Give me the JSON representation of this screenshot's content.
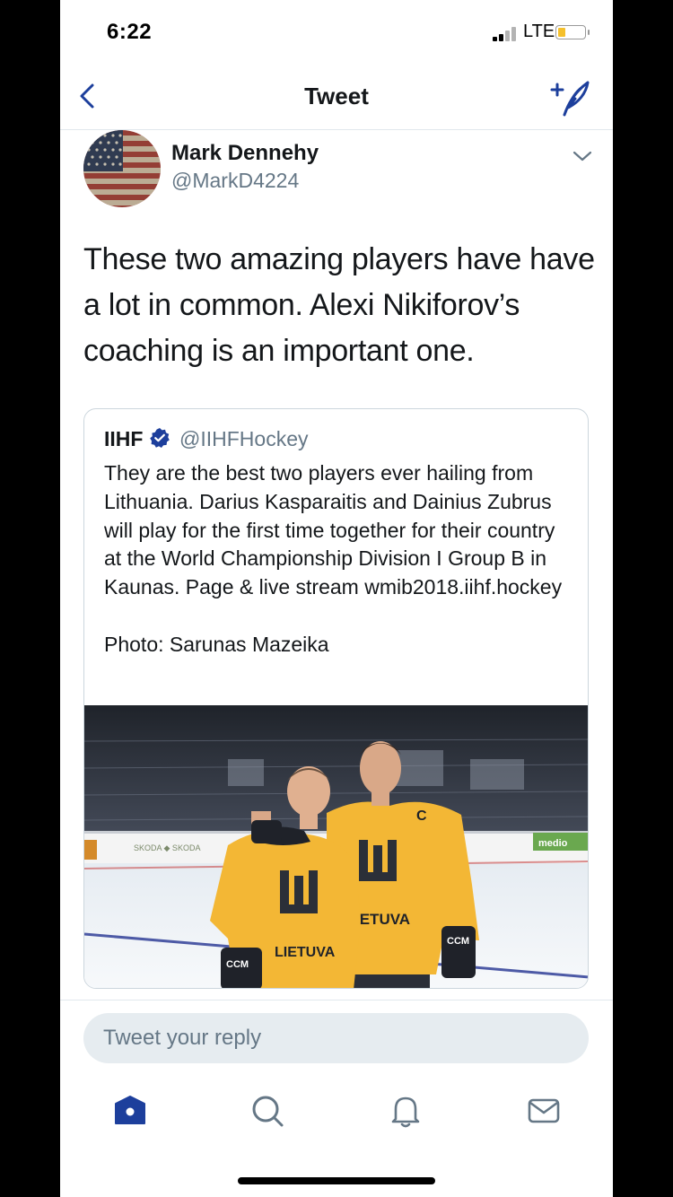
{
  "status_bar": {
    "time": "6:22",
    "carrier": "LTE",
    "battery_color": "#f5c02c"
  },
  "nav": {
    "title": "Tweet",
    "back_icon": "chevron-left-icon",
    "compose_icon": "compose-tweet-icon"
  },
  "tweet": {
    "author_name": "Mark Dennehy",
    "author_handle": "@MarkD4224",
    "text": "These two amazing players have have a lot in common.  Alexi Nikiforov’s coaching is an important one."
  },
  "quote": {
    "name": "IIHF",
    "handle": "@IIHFHockey",
    "verified_icon": "verified-badge-icon",
    "text": "They are the best two players ever hailing from Lithuania. Darius Kasparaitis and Dainius Zubrus will play for the first time together for their country at the World Championship Division I Group B in Kaunas. Page & live stream wmib2018.iihf.hockey\n\nPhoto: Sarunas Mazeika",
    "photo": {
      "jersey_text": "LIETUVA",
      "captain_mark": "C",
      "glove_left": "CCM",
      "glove_right": "CCM",
      "board_ads": "SKODA SKODA",
      "board_ad_right": "medio"
    }
  },
  "reply": {
    "placeholder": "Tweet your reply"
  },
  "tabs": [
    {
      "name": "home",
      "icon": "home-icon",
      "active": true
    },
    {
      "name": "search",
      "icon": "search-icon",
      "active": false
    },
    {
      "name": "notifications",
      "icon": "bell-icon",
      "active": false
    },
    {
      "name": "messages",
      "icon": "mail-icon",
      "active": false
    }
  ],
  "colors": {
    "accent": "#1d3f9c",
    "text": "#14171a",
    "secondary": "#657786",
    "jersey": "#f3b735"
  }
}
